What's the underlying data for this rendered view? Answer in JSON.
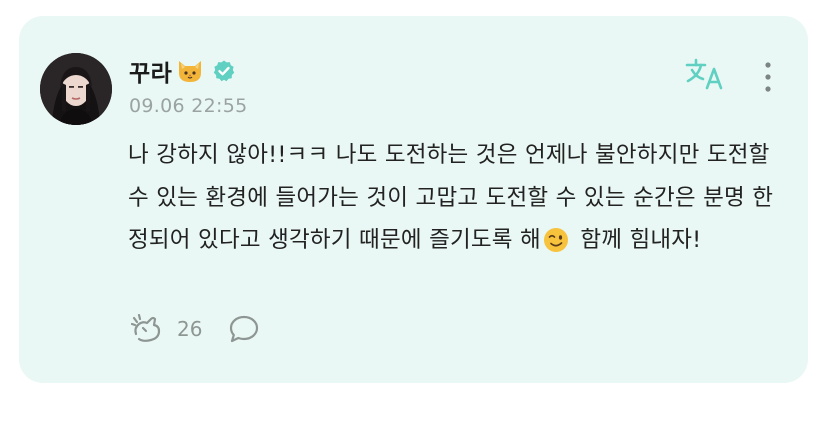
{
  "post": {
    "author": "꾸라",
    "author_emoji": "cat-face-emoji",
    "verified_icon": "verified-badge-icon",
    "timestamp": "09.06 22:55",
    "text_before_emoji": "나 강하지 않아!!ㅋㅋ 나도 도전하는 것은 언제나 불안하지만 도전할 수 있는 환경에 들어가는 것이 고맙고 도전할 수 있는 순간은 분명 한정되어 있다고 생각하기 때문에 즐기도록 해",
    "inline_emoji": "winking-face-emoji",
    "text_after_emoji": " 함께 힘내자!",
    "like_count": "26"
  },
  "icons": {
    "translate": "translate-icon",
    "more": "more-vertical-icon",
    "like": "like-icon",
    "comment": "comment-icon"
  },
  "colors": {
    "card_background": "#e9f8f4",
    "accent": "#5fd0c1",
    "text": "#222222",
    "muted": "#9aa3a1"
  }
}
